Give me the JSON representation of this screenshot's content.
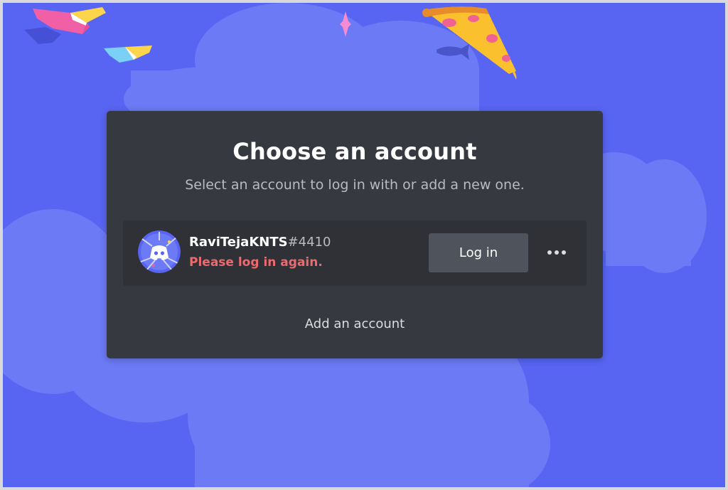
{
  "modal": {
    "title": "Choose an account",
    "subtitle": "Select an account to log in with or add a new one."
  },
  "account": {
    "username": "RaviTejaKNTS",
    "discriminator": "#4410",
    "status": "Please log in again.",
    "login_label": "Log in",
    "more_icon": "more-horizontal-icon",
    "avatar_icon": "discord-logo-icon"
  },
  "add_account_label": "Add an account",
  "colors": {
    "background": "#5865f2",
    "cloud": "#6c7af5",
    "modal": "#36393f",
    "row": "#2f3136",
    "button": "#4f545c",
    "error": "#ed6a6f"
  }
}
